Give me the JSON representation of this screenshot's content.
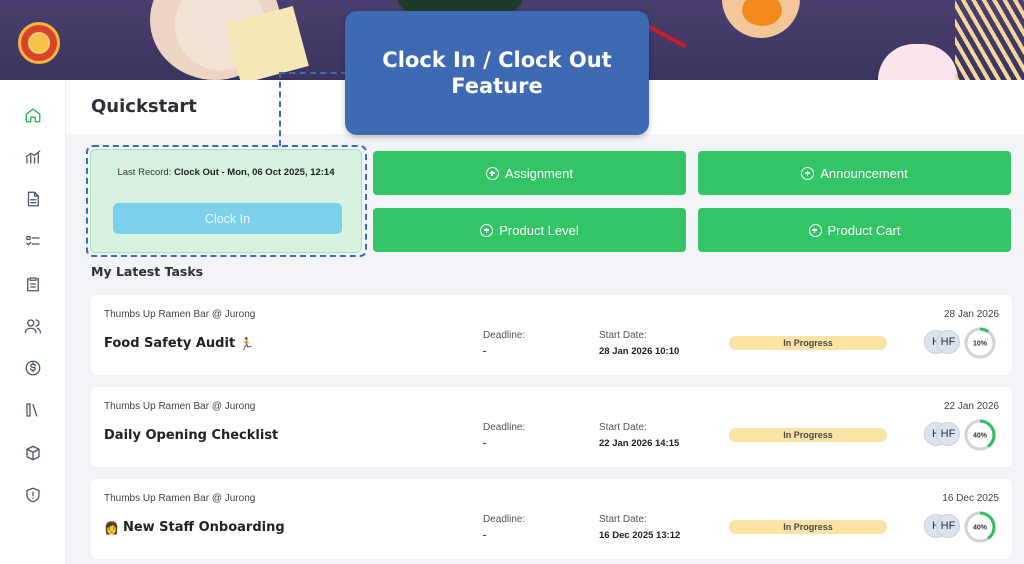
{
  "callout": {
    "line1": "Clock In / Clock Out",
    "line2": "Feature"
  },
  "page": {
    "title": "Quickstart"
  },
  "sidebar": {
    "items": [
      {
        "icon": "home-icon"
      },
      {
        "icon": "chart-icon"
      },
      {
        "icon": "document-icon"
      },
      {
        "icon": "checklist-icon"
      },
      {
        "icon": "clipboard-icon"
      },
      {
        "icon": "users-icon"
      },
      {
        "icon": "dollar-icon"
      },
      {
        "icon": "library-icon"
      },
      {
        "icon": "box-icon"
      },
      {
        "icon": "shield-icon"
      }
    ]
  },
  "clock": {
    "last_record_label": "Last Record:",
    "last_record_value": "Clock Out - Mon, 06 Oct 2025, 12:14",
    "button_label": "Clock In"
  },
  "quick_actions": [
    {
      "label": "Assignment"
    },
    {
      "label": "Announcement"
    },
    {
      "label": "Product Level"
    },
    {
      "label": "Product Cart"
    }
  ],
  "tasks_section": {
    "title": "My Latest Tasks"
  },
  "tasks": [
    {
      "location": "Thumbs Up Ramen Bar @ Jurong",
      "name": "Food Safety Audit",
      "emoji_after": "🏃",
      "emoji_before": "",
      "deadline_label": "Deadline:",
      "deadline": "-",
      "start_label": "Start Date:",
      "start": "28 Jan 2026 10:10",
      "status": "In Progress",
      "date": "28 Jan 2026",
      "avatar1": "H",
      "avatar2": "HF",
      "progress_text": "10%",
      "progress": 0.1
    },
    {
      "location": "Thumbs Up Ramen Bar @ Jurong",
      "name": "Daily Opening Checklist",
      "emoji_after": "",
      "emoji_before": "",
      "deadline_label": "Deadline:",
      "deadline": "-",
      "start_label": "Start Date:",
      "start": "22 Jan 2026 14:15",
      "status": "In Progress",
      "date": "22 Jan 2026",
      "avatar1": "H",
      "avatar2": "HF",
      "progress_text": "40%",
      "progress": 0.4
    },
    {
      "location": "Thumbs Up Ramen Bar @ Jurong",
      "name": "New Staff Onboarding",
      "emoji_after": "",
      "emoji_before": "👩",
      "deadline_label": "Deadline:",
      "deadline": "-",
      "start_label": "Start Date:",
      "start": "16 Dec 2025 13:12",
      "status": "In Progress",
      "date": "16 Dec 2025",
      "avatar1": "H",
      "avatar2": "HF",
      "progress_text": "40%",
      "progress": 0.4
    }
  ],
  "colors": {
    "accent_green": "#33c565",
    "callout_blue": "#3e6ab3",
    "status_bg": "#fbe3a6",
    "clock_button": "#7dd0ec"
  }
}
